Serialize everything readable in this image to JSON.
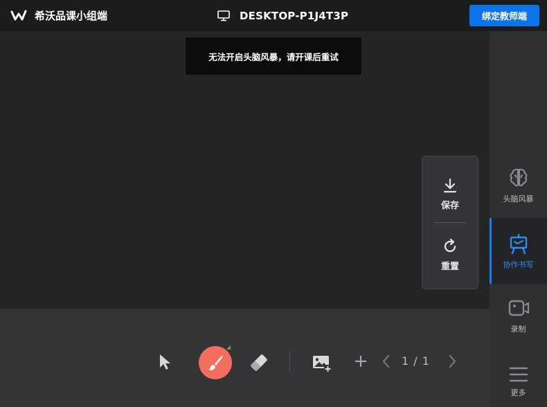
{
  "header": {
    "app_title": "希沃品课小组端",
    "device_name": "DESKTOP-P1J4T3P",
    "bind_button_label": "绑定教师端"
  },
  "toast": {
    "message": "无法开启头脑风暴，请开课后重试"
  },
  "float_panel": {
    "save_label": "保存",
    "reset_label": "重置"
  },
  "sidebar": {
    "items": [
      {
        "label": "头脑风暴",
        "icon": "brain-icon",
        "active": false
      },
      {
        "label": "协作书写",
        "icon": "easel-icon",
        "active": true
      },
      {
        "label": "录制",
        "icon": "video-camera-icon",
        "active": false
      },
      {
        "label": "更多",
        "icon": "menu-icon",
        "active": false
      }
    ]
  },
  "toolbar": {
    "tools": [
      "pointer-icon",
      "brush-icon",
      "eraser-icon",
      "insert-image-icon",
      "add-page-icon",
      "prev-page-icon",
      "next-page-icon"
    ],
    "active_tool": "brush-icon",
    "page_indicator": "1 / 1"
  },
  "colors": {
    "accent": "#0d74ea",
    "active_tool": "#f36e5f",
    "active_sidebar": "#2f8cf5"
  }
}
